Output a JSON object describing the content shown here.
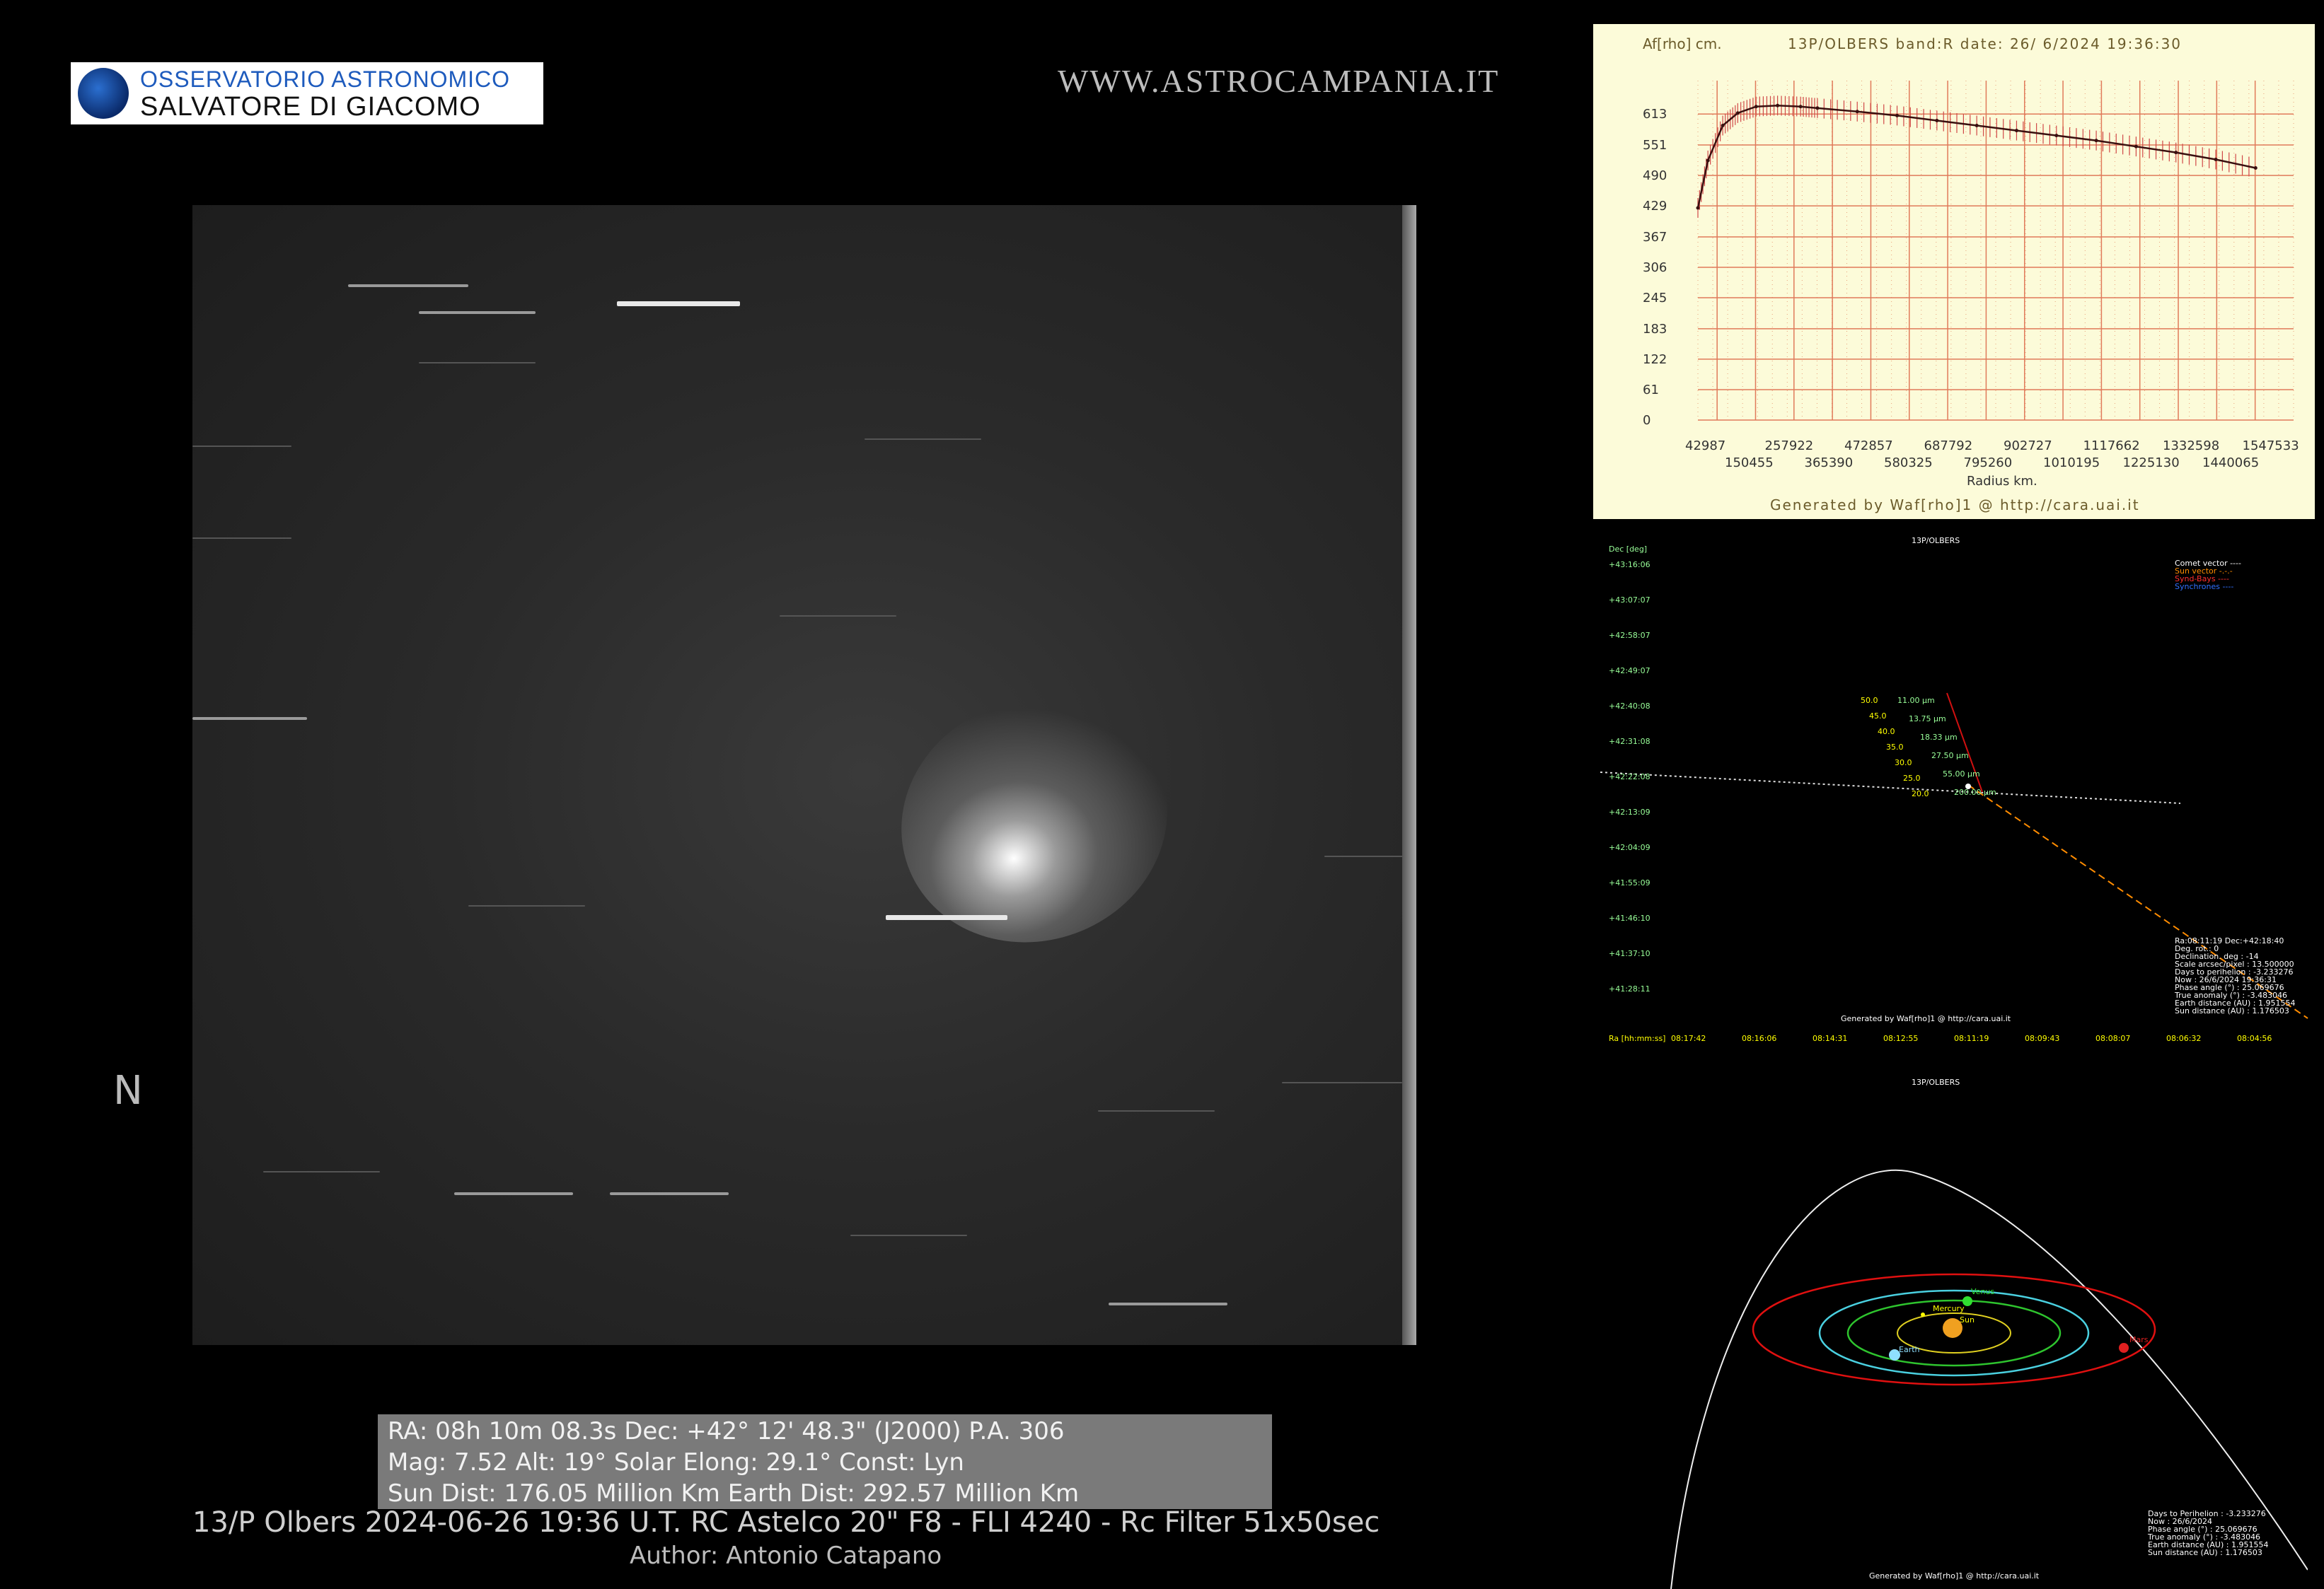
{
  "logo": {
    "line1": "OSSERVATORIO ASTRONOMICO",
    "line2": "SALVATORE DI GIACOMO"
  },
  "website": "WWW.ASTROCAMPANIA.IT",
  "north_label": "N",
  "info": {
    "line1": "RA: 08h 10m 08.3s    Dec:  +42° 12' 48.3\" (J2000)  P.A. 306",
    "line2": "Mag: 7.52 Alt: 19° Solar Elong: 29.1° Const: Lyn",
    "line3": "Sun Dist: 176.05 Million Km    Earth Dist: 292.57 Million Km"
  },
  "caption": "13/P Olbers   2024-06-26   19:36 U.T.   RC Astelco 20\" F8 - FLI 4240 - Rc Filter 51x50sec",
  "author": "Author: Antonio Catapano",
  "afrho_panel": {
    "ylabel": "Af[rho] cm.",
    "title": "13P/OLBERS band:R date: 26/ 6/2024 19:36:30",
    "xlabel": "Radius km.",
    "footer": "Generated by Waf[rho]1 @ http://cara.uai.it",
    "y_ticks": [
      "613",
      "551",
      "490",
      "429",
      "367",
      "306",
      "245",
      "183",
      "122",
      "61",
      "0"
    ],
    "x_ticks_top": [
      "42987",
      "257922",
      "472857",
      "687792",
      "902727",
      "1117662",
      "1332598",
      "1547533"
    ],
    "x_ticks_bottom": [
      "150455",
      "365390",
      "580325",
      "795260",
      "1010195",
      "1225130",
      "1440065"
    ]
  },
  "chart_data": {
    "type": "line",
    "title": "13P/OLBERS band:R date: 26/ 6/2024 19:36:30",
    "xlabel": "Radius km.",
    "ylabel": "Af[rho] cm.",
    "ylim": [
      0,
      680
    ],
    "xlim": [
      42987,
      1650000
    ],
    "grid": true,
    "x": [
      42987,
      70000,
      110000,
      150455,
      200000,
      257922,
      320000,
      365390,
      472857,
      580325,
      687792,
      795260,
      902727,
      1010195,
      1117662,
      1225130,
      1332598,
      1440065,
      1547533
    ],
    "values": [
      425,
      520,
      590,
      615,
      628,
      630,
      628,
      625,
      618,
      610,
      600,
      590,
      580,
      570,
      560,
      548,
      536,
      522,
      505
    ]
  },
  "sky_panel": {
    "title": "13P/OLBERS",
    "axis_label": "Dec [deg]",
    "dec_ticks": [
      "+43:16:06",
      "+43:07:07",
      "+42:58:07",
      "+42:49:07",
      "+42:40:08",
      "+42:31:08",
      "+42:22:08",
      "+42:13:09",
      "+42:04:09",
      "+41:55:09",
      "+41:46:10",
      "+41:37:10",
      "+41:28:11"
    ],
    "ra_label": "Ra [hh:mm:ss]",
    "ra_ticks": [
      "08:17:42",
      "08:16:06",
      "08:14:31",
      "08:12:55",
      "08:11:19",
      "08:09:43",
      "08:08:07",
      "08:06:32",
      "08:04:56"
    ],
    "legend": [
      "Comet vector ----",
      "Sun vector -.-.-",
      "Synd-Bays ----",
      "Synchrones ----"
    ],
    "left_labels": [
      "50.0",
      "45.0",
      "40.0",
      "35.0",
      "30.0",
      "25.0",
      "20.0"
    ],
    "right_labels": [
      "11.00 µm",
      "13.75 µm",
      "18.33 µm",
      "27.50 µm",
      "55.00 µm",
      "200.00 µm"
    ],
    "stats": [
      "Ra:08:11:19 Dec:+42:18:40",
      "Deg. rot.: 0",
      "Declination. deg : -14",
      "Scale arcsec/pixel : 13.500000",
      "Days to perihelion : -3.233276",
      "Now : 26/6/2024 19:36:31",
      "Phase angle (°) : 25.069676",
      "True anomaly (°) : -3.483046",
      "Earth distance (AU) : 1.951554",
      "Sun distance (AU) : 1.176503"
    ],
    "footer": "Generated by Waf[rho]1 @ http://cara.uai.it"
  },
  "orbit_panel": {
    "title": "13P/OLBERS",
    "planets": [
      "Venus",
      "Mercury",
      "Sun",
      "Earth",
      "Mars"
    ],
    "stats": [
      "Days to Perihelion : -3.233276",
      "Now : 26/6/2024",
      "Phase angle (°) : 25.069676",
      "True anomaly (°) : -3.483046",
      "Earth distance (AU) : 1.951554",
      "Sun distance (AU) : 1.176503"
    ],
    "footer": "Generated by Waf[rho]1 @ http://cara.uai.it"
  }
}
